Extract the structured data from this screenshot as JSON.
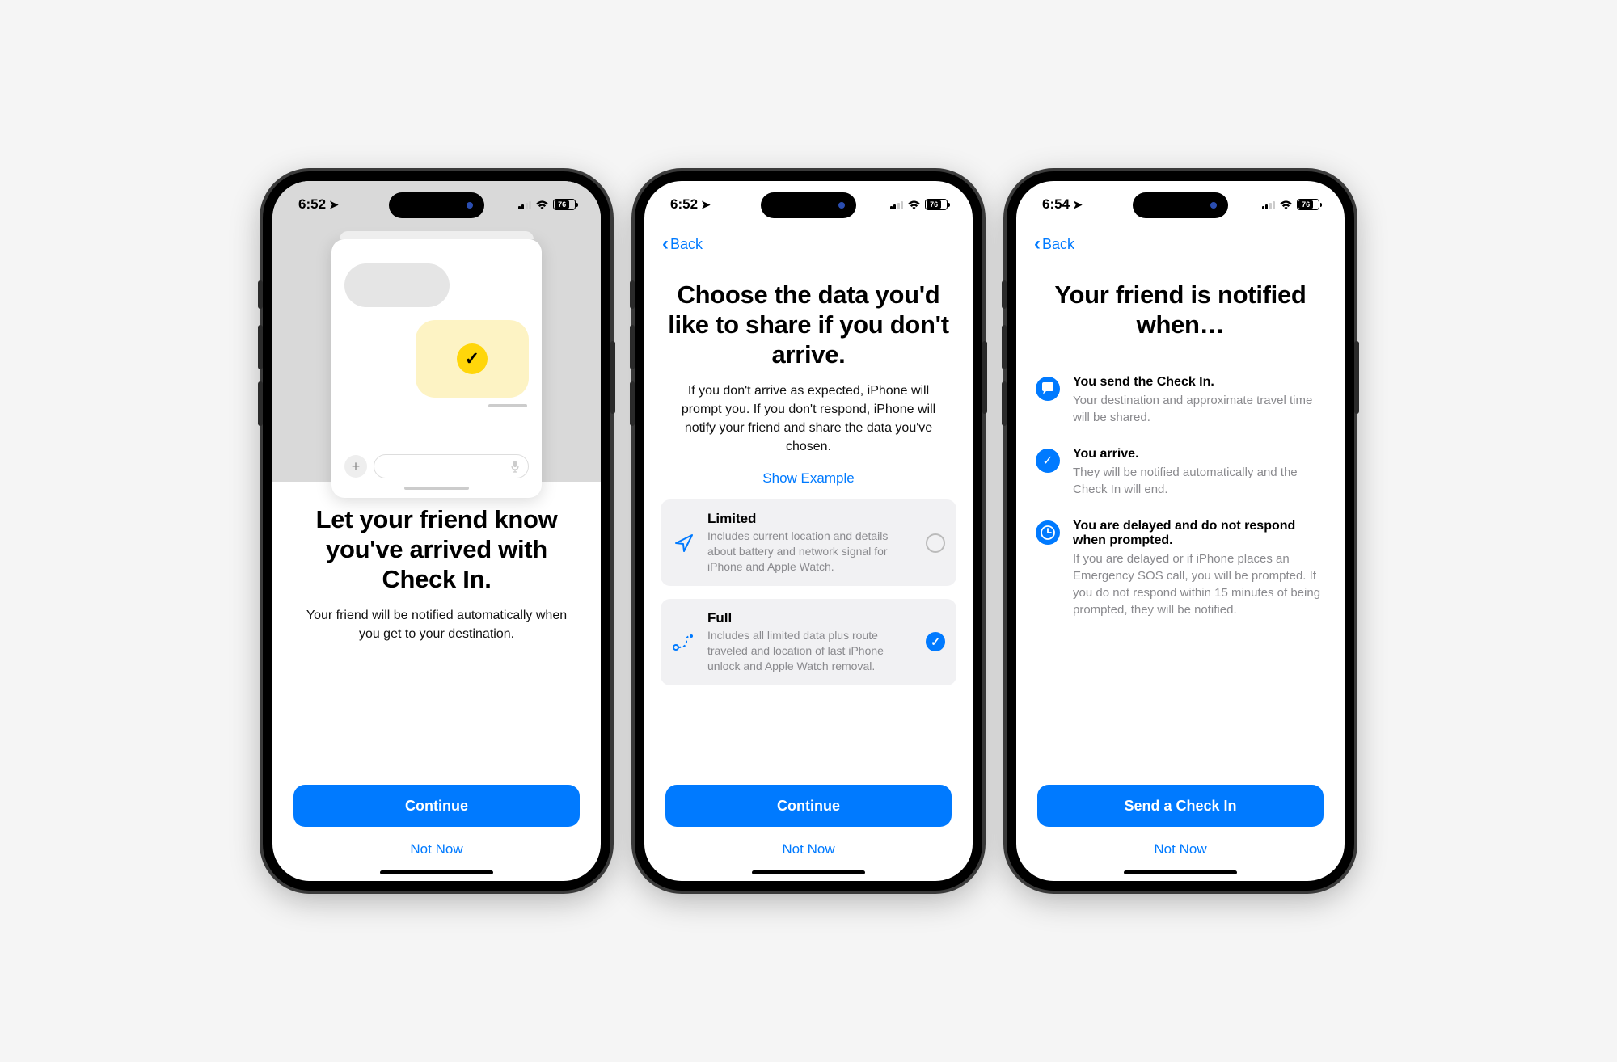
{
  "status": {
    "time1": "6:52",
    "time2": "6:52",
    "time3": "6:54",
    "battery": "76"
  },
  "nav": {
    "back": "Back"
  },
  "screen1": {
    "title": "Let your friend know you've arrived with Check In.",
    "subtitle": "Your friend will be notified automatically when you get to your destination.",
    "primary": "Continue",
    "secondary": "Not Now"
  },
  "screen2": {
    "title": "Choose the data you'd like to share if you don't arrive.",
    "subtitle": "If you don't arrive as expected, iPhone will prompt you. If you don't respond, iPhone will notify your friend and share the data you've chosen.",
    "show_example": "Show Example",
    "options": [
      {
        "title": "Limited",
        "desc": "Includes current location and details about battery and network signal for iPhone and Apple Watch.",
        "selected": false
      },
      {
        "title": "Full",
        "desc": "Includes all limited data plus route traveled and location of last iPhone unlock and Apple Watch removal.",
        "selected": true
      }
    ],
    "primary": "Continue",
    "secondary": "Not Now"
  },
  "screen3": {
    "title": "Your friend is notified when…",
    "items": [
      {
        "title": "You send the Check In.",
        "desc": "Your destination and approximate travel time will be shared."
      },
      {
        "title": "You arrive.",
        "desc": "They will be notified automatically and the Check In will end."
      },
      {
        "title": "You are delayed and do not respond when prompted.",
        "desc": "If you are delayed or if iPhone places an Emergency SOS call, you will be prompted. If you do not respond within 15 minutes of being prompted, they will be notified."
      }
    ],
    "primary": "Send a Check In",
    "secondary": "Not Now"
  }
}
